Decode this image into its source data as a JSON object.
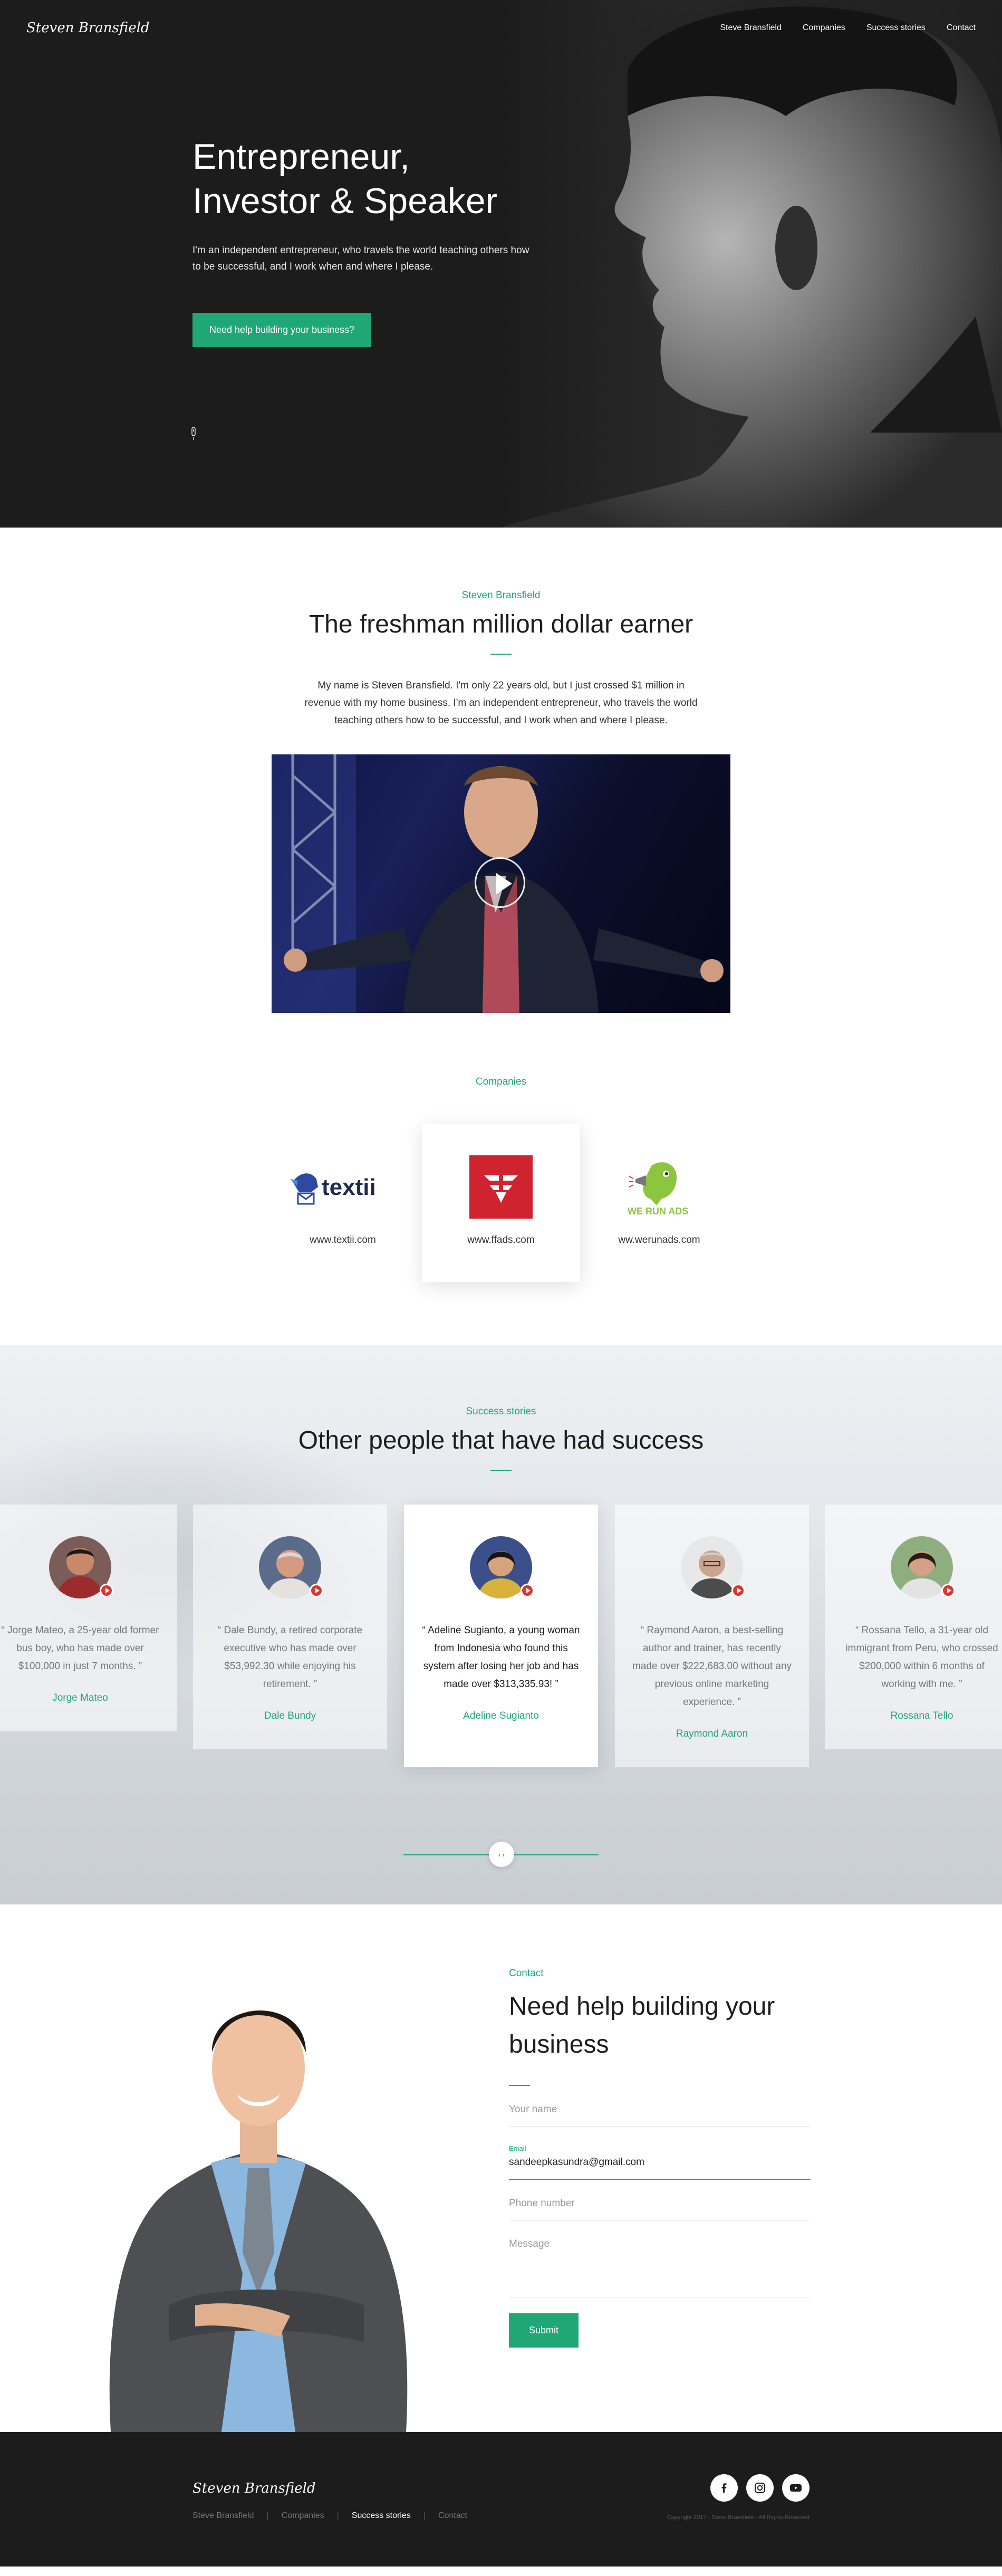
{
  "brand": {
    "logo_text": "Steven Bransfield"
  },
  "nav": {
    "items": [
      {
        "label": "Steve Bransfield"
      },
      {
        "label": "Companies"
      },
      {
        "label": "Success stories"
      },
      {
        "label": "Contact"
      }
    ]
  },
  "hero": {
    "title_line1": "Entrepreneur,",
    "title_line2": "Investor & Speaker",
    "text": "I'm an independent entrepreneur, who travels the world teaching others how to be successful, and I work when and where I please.",
    "cta_label": "Need help building your business?"
  },
  "intro": {
    "label": "Steven Bransfield",
    "title": "The freshman million dollar earner",
    "text": "My name is Steven Bransfield. I'm only 22 years old, but I just crossed $1 million in revenue with my home business. I'm an independent entrepreneur, who travels the world teaching others how to be successful, and I work when and where I please."
  },
  "companies": {
    "label": "Companies",
    "items": [
      {
        "logo_text": "textii",
        "url": "www.textii.com"
      },
      {
        "logo_text": "",
        "url": "www.ffads.com"
      },
      {
        "logo_text": "WE RUN ADS",
        "url": "ww.werunads.com"
      }
    ]
  },
  "stories": {
    "label": "Success stories",
    "title": "Other people that have had success",
    "items": [
      {
        "quote": "“ Jorge Mateo, a 25-year old former bus boy, who has made over $100,000 in just 7 months. ”",
        "name": "Jorge Mateo"
      },
      {
        "quote": "“ Dale Bundy, a retired corporate executive who has made over $53,992.30 while enjoying his retirement. ”",
        "name": "Dale Bundy"
      },
      {
        "quote": "“ Adeline Sugianto, a young woman from Indonesia who found this system after losing her job and has made over $313,335.93! ”",
        "name": "Adeline Sugianto"
      },
      {
        "quote": "“ Raymond Aaron, a best-selling author and trainer, has recently made over $222,683.00 without any previous online marketing experience. ”",
        "name": "Raymond Aaron"
      },
      {
        "quote": "“ Rossana Tello, a 31-year old immigrant from Peru, who crossed $200,000 within 6 months of working with me. ”",
        "name": "Rossana Tello"
      }
    ]
  },
  "contact": {
    "label": "Contact",
    "title": "Need help building your business",
    "name_placeholder": "Your name",
    "email_label": "Email",
    "email_value": "sandeepkasundra@gmail.com",
    "phone_placeholder": "Phone number",
    "message_placeholder": "Message",
    "submit_label": "Submit"
  },
  "footer": {
    "logo_text": "Steven Bransfield",
    "nav": [
      {
        "label": "Steve Bransfield"
      },
      {
        "label": "Companies"
      },
      {
        "label": "Success stories"
      },
      {
        "label": "Contact"
      }
    ],
    "copyright": "Copyright 2017 - Steve Bransfield - All Rights Reserved",
    "socials": [
      "facebook-icon",
      "instagram-icon",
      "youtube-icon"
    ]
  },
  "colors": {
    "accent": "#1fa876",
    "dark": "#1c1c1d",
    "badge": "#d9372f"
  }
}
